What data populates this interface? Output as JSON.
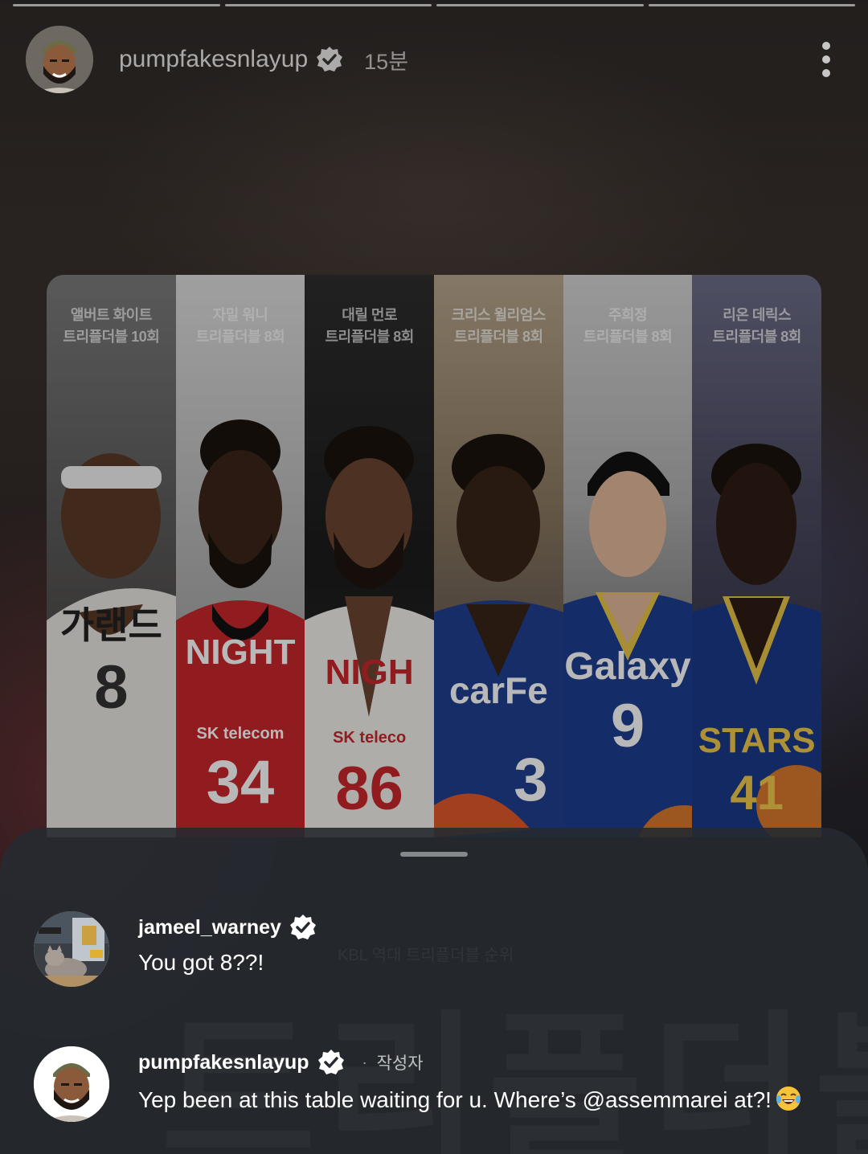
{
  "story": {
    "progress_segments": 4,
    "author": {
      "username": "pumpfakesnlayup",
      "verified": true,
      "posted_ago": "15분",
      "avatar_icon": "bearded-man-cap-avatar"
    },
    "menu_icon": "more-vertical-icon"
  },
  "graphic": {
    "watermark_subtitle": "KBL 역대 트리플더블 순위",
    "watermark_title": "트리플더블",
    "players": [
      {
        "name": "앨버트 화이트",
        "record": "트리플더블 10회",
        "jersey_text": "가랜드",
        "jersey_number": "8",
        "bg": "#8a8a8a",
        "jersey_color": "#e9e6e1",
        "skin": "#5a3a28"
      },
      {
        "name": "자밀 워니",
        "record": "트리플더블 8회",
        "jersey_text": "NIGHT",
        "sponsor": "SK telecom",
        "jersey_number": "34",
        "bg": "#d9d9d9",
        "jersey_color": "#c8272d",
        "skin": "#3b2518"
      },
      {
        "name": "대릴 먼로",
        "record": "트리플더블 8회",
        "jersey_text": "NIGH",
        "sponsor": "SK teleco",
        "jersey_number": "86",
        "bg": "#2b2b2b",
        "jersey_color": "#f3f0ec",
        "skin": "#6b4530"
      },
      {
        "name": "크리스 윌리엄스",
        "record": "트리플더블 8회",
        "jersey_text": "carFe",
        "jersey_number": "3",
        "bg": "#b7a58a",
        "jersey_color": "#1f3f8f",
        "skin": "#3a2418"
      },
      {
        "name": "주희정",
        "record": "트리플더블 8회",
        "jersey_text": "Galaxy",
        "jersey_number": "9",
        "bg": "#cfcfcf",
        "jersey_color": "#1c3d8f",
        "skin": "#e2b99a"
      },
      {
        "name": "리온 데릭스",
        "record": "트리플더블 8회",
        "jersey_text": "STARS",
        "jersey_number": "41",
        "bg": "#6e6e8a",
        "jersey_color": "#1a3a8a",
        "skin": "#2e1c14"
      }
    ]
  },
  "replies": {
    "grabber": "sheet-handle",
    "comments": [
      {
        "username": "jameel_warney",
        "verified": true,
        "is_author": false,
        "text": "You got 8??!",
        "avatar_icon": "cat-room-avatar"
      },
      {
        "username": "pumpfakesnlayup",
        "verified": true,
        "is_author": true,
        "author_separator": "·",
        "author_label": "작성자",
        "text": "Yep been at this table waiting for u. Where’s @assemmarei at?!",
        "emoji": "face-with-tears-of-joy"
      }
    ]
  },
  "colors": {
    "verified_badge": "#ffffff",
    "sheet_bg": "#262a30"
  }
}
